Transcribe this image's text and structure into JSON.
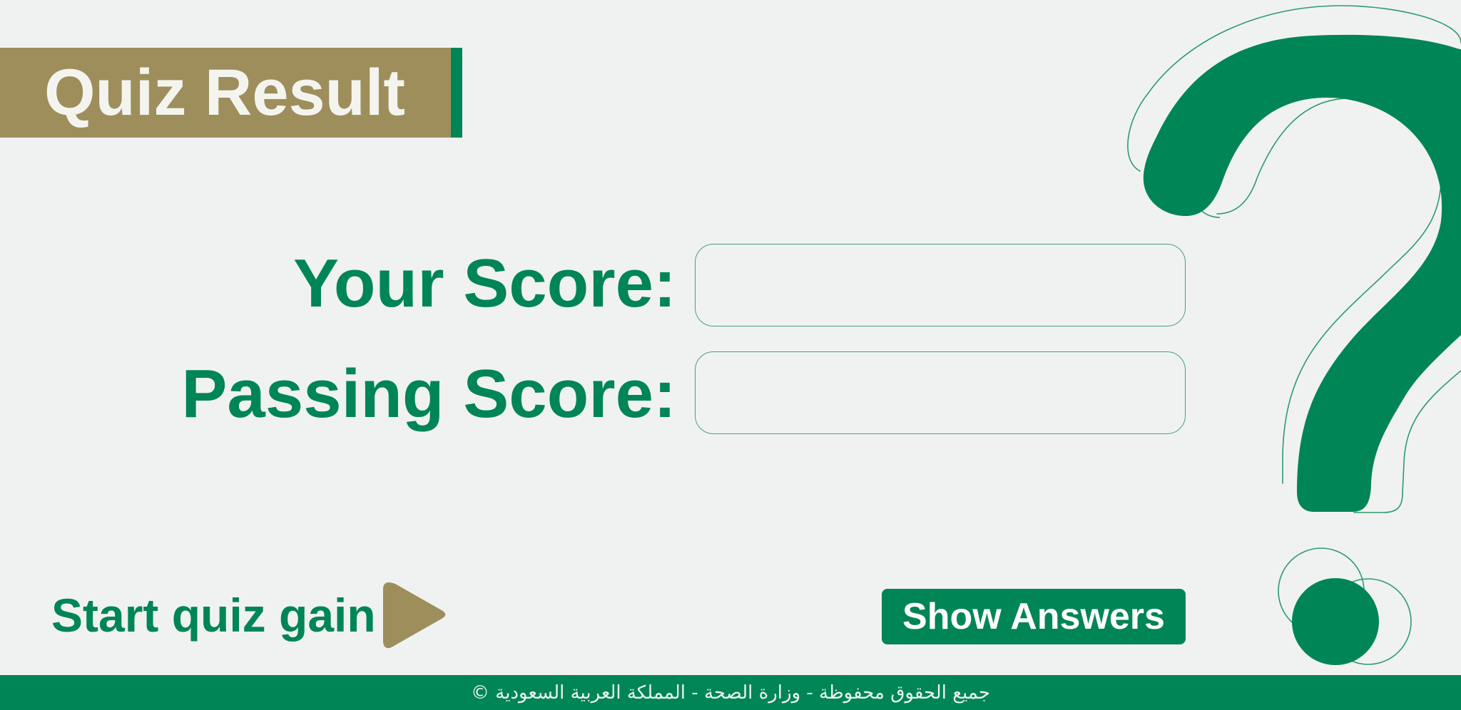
{
  "header": {
    "title": "Quiz Result"
  },
  "scores": {
    "your_score_label": "Your Score:",
    "your_score_value": "",
    "passing_score_label": "Passing Score:",
    "passing_score_value": ""
  },
  "actions": {
    "start_again_label": "Start quiz gain",
    "show_answers_label": "Show Answers"
  },
  "footer": {
    "copyright": "جميع الحقوق محفوظة - وزارة الصحة - المملكة العربية السعودية ©"
  },
  "colors": {
    "primary_green": "#008556",
    "gold": "#9e8e5c",
    "background": "#f0f2f1"
  },
  "icons": {
    "play": "play-triangle-icon",
    "decoration": "question-mark-icon"
  }
}
